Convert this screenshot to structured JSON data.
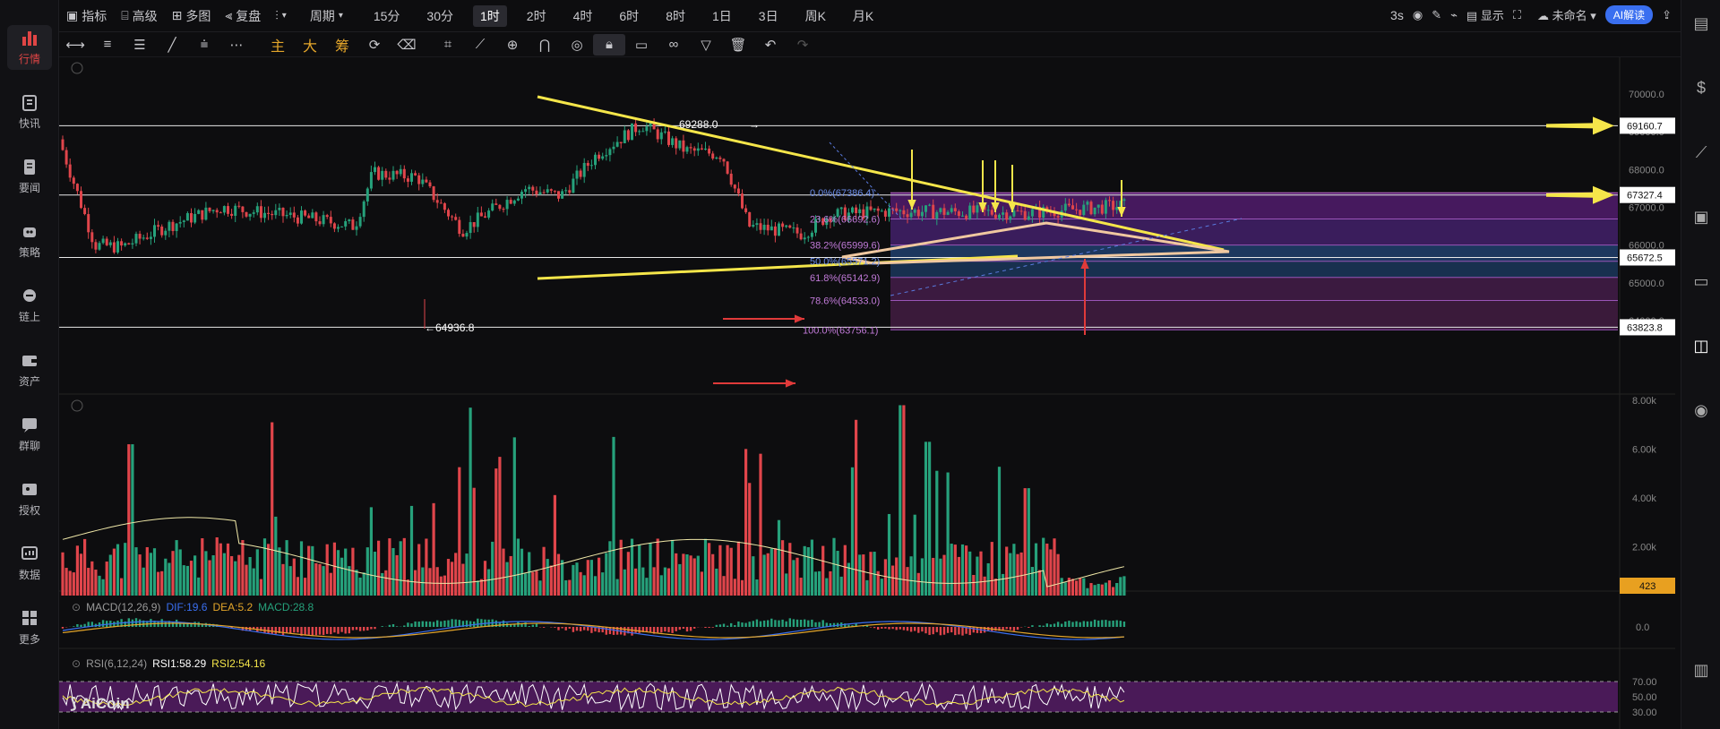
{
  "topbar": {
    "indicators": "指标",
    "advanced": "高级",
    "multi": "多图",
    "replay": "复盘",
    "period": "周期",
    "intervals": [
      "15分",
      "30分",
      "1时",
      "2时",
      "4时",
      "6时",
      "8时",
      "1日",
      "3日",
      "周K",
      "月K"
    ],
    "active_interval": "1时",
    "refresh": "3s",
    "display": "显示",
    "workspace": "未命名",
    "ai": "AI解读"
  },
  "toolbar": {
    "main": "主",
    "big": "大",
    "chips": "筹"
  },
  "nav": [
    {
      "label": "行情",
      "icon": "chart-bars-icon",
      "active": true
    },
    {
      "label": "快讯",
      "icon": "news-flash-icon",
      "active": false
    },
    {
      "label": "要闻",
      "icon": "document-icon",
      "active": false
    },
    {
      "label": "策略",
      "icon": "robot-icon",
      "active": false
    },
    {
      "label": "链上",
      "icon": "chain-icon",
      "active": false
    },
    {
      "label": "资产",
      "icon": "wallet-icon",
      "active": false
    },
    {
      "label": "群聊",
      "icon": "chat-icon",
      "active": false
    },
    {
      "label": "授权",
      "icon": "key-icon",
      "active": false
    },
    {
      "label": "数据",
      "icon": "data-board-icon",
      "active": false
    },
    {
      "label": "更多",
      "icon": "grid-more-icon",
      "active": false
    }
  ],
  "price_axis": {
    "ticks": [
      "70000.0",
      "69000.0",
      "68000.0",
      "67000.0",
      "66000.0",
      "65000.0",
      "64000.0"
    ],
    "tags": [
      {
        "label": "69160.7",
        "value": 69160.7
      },
      {
        "label": "67327.4",
        "value": 67327.4
      },
      {
        "label": "65672.5",
        "value": 65672.5
      },
      {
        "label": "63823.8",
        "value": 63823.8
      }
    ]
  },
  "annotations": {
    "high": "69288.0",
    "low": "64936.8"
  },
  "fib_levels": [
    {
      "label": "0.0%(67386.4)",
      "value": 67386.4
    },
    {
      "label": "23.6%(66692.6)",
      "value": 66692.6
    },
    {
      "label": "38.2%(65999.6)",
      "value": 65999.6
    },
    {
      "label": "50.0%(65571.2)",
      "value": 65571.2
    },
    {
      "label": "61.8%(65142.9)",
      "value": 65142.9
    },
    {
      "label": "78.6%(64533.0)",
      "value": 64533.0
    },
    {
      "label": "100.0%(63756.1)",
      "value": 63756.1
    }
  ],
  "volume_axis": {
    "ticks": [
      "8.00k",
      "6.00k",
      "4.00k",
      "2.00k"
    ],
    "current": "423"
  },
  "macd": {
    "title": "MACD(12,26,9)",
    "dif": "DIF:19.6",
    "dea": "DEA:5.2",
    "macd": "MACD:28.8",
    "zero": "0.0"
  },
  "rsi": {
    "title": "RSI(6,12,24)",
    "rsi1": "RSI1:58.29",
    "rsi2": "RSI2:54.16",
    "ticks": [
      "70.00",
      "50.00",
      "30.00"
    ]
  },
  "brand": "AiCoin",
  "colors": {
    "up": "#26a17b",
    "down": "#e0454b",
    "trend": "#f5e64a",
    "fib_zone": "#5b1f7a",
    "accent": "#3a6ff0"
  }
}
